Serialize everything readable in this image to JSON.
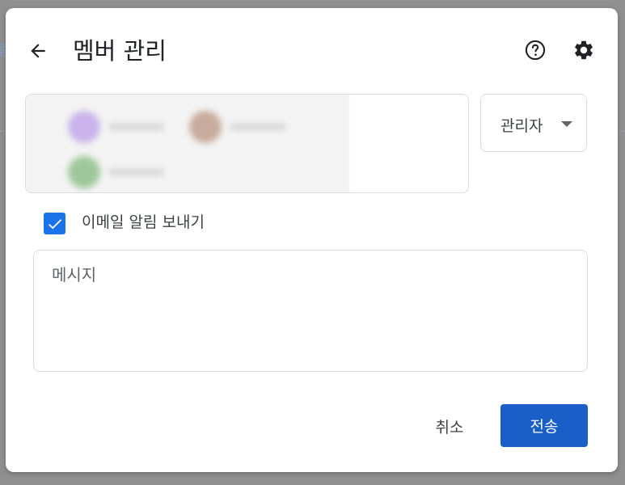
{
  "backdrop": {
    "peek_char": "렁"
  },
  "dialog": {
    "title": "멤버 관리",
    "back_icon": "arrow-left-icon",
    "help_icon": "help-circle-icon",
    "settings_icon": "gear-icon"
  },
  "role": {
    "selected": "관리자"
  },
  "notify": {
    "checked": true,
    "label": "이메일 알림 보내기"
  },
  "message": {
    "placeholder": "메시지",
    "value": ""
  },
  "actions": {
    "cancel_label": "취소",
    "send_label": "전송"
  },
  "colors": {
    "accent": "#1a73e8",
    "send_button": "#1a5fc8"
  }
}
